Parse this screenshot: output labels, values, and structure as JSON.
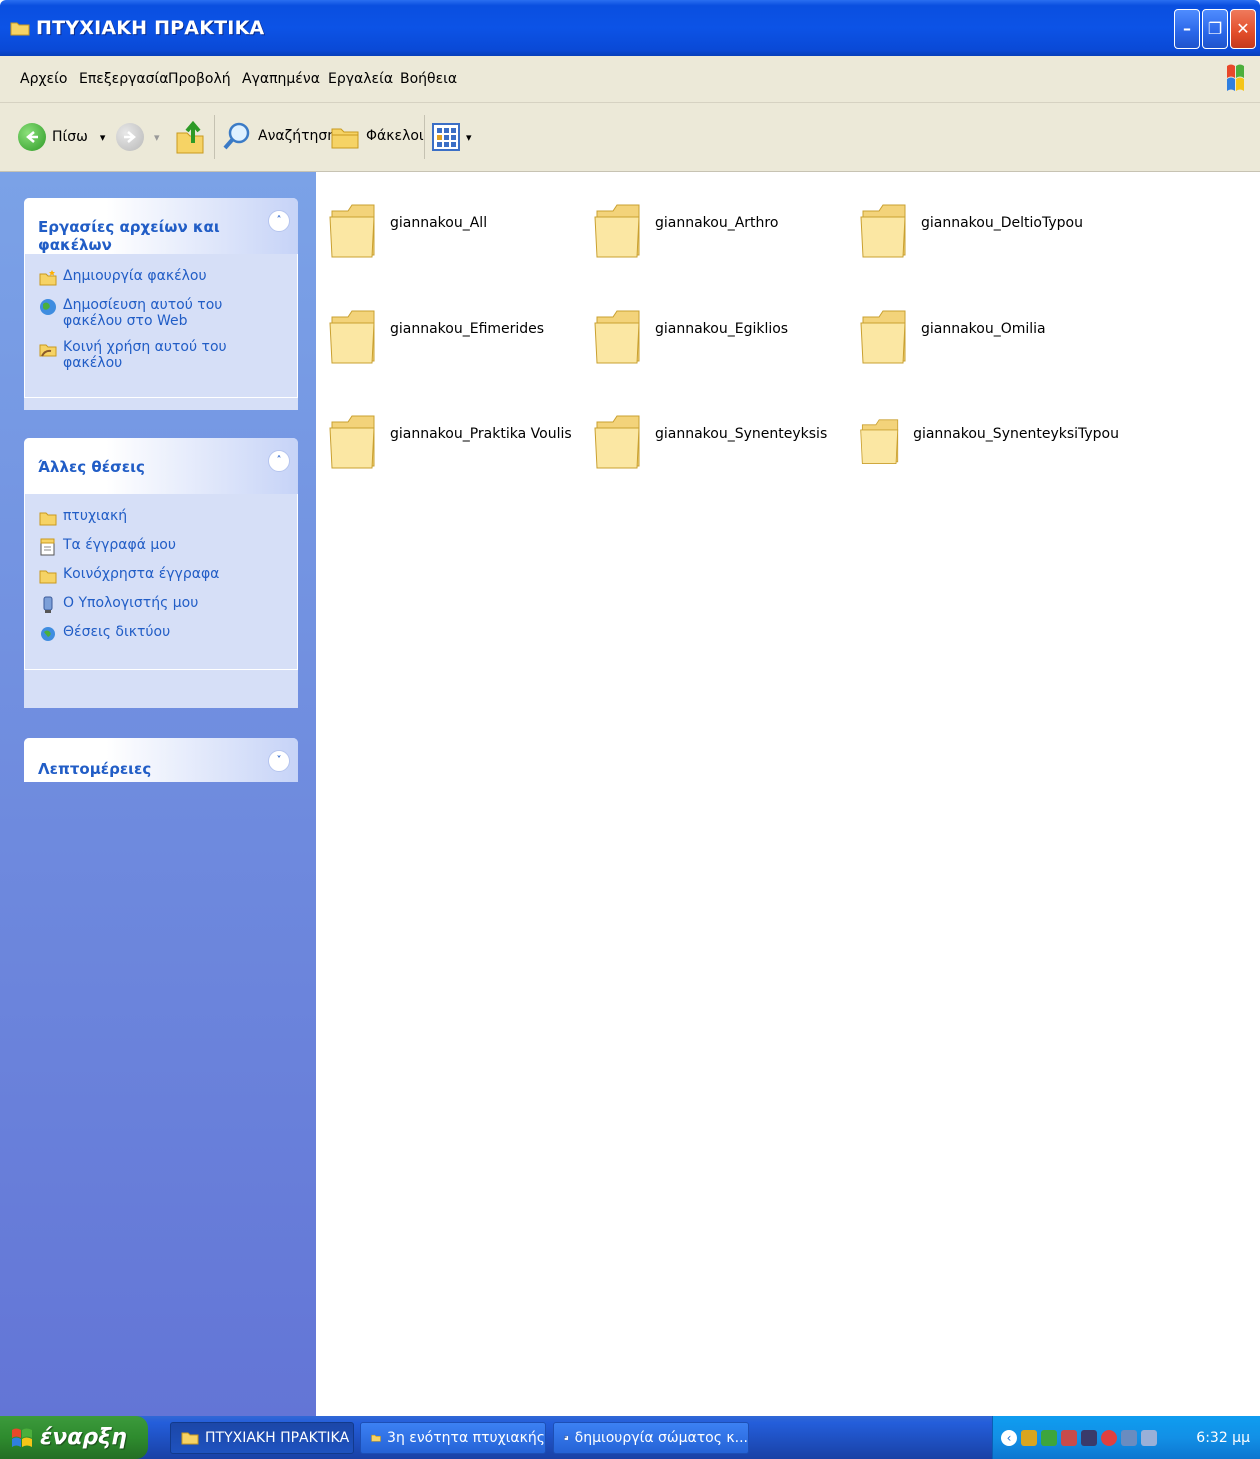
{
  "window": {
    "title": "ΠΤΥΧΙΑΚΗ ΠΡΑΚΤΙΚΑ",
    "minimize": "–",
    "restore": "❐",
    "close": "✕"
  },
  "menubar": {
    "items": [
      "Αρχείο",
      "Επεξεργασία",
      "Προβολή",
      "Αγαπημένα",
      "Εργαλεία",
      "Βοήθεια"
    ]
  },
  "toolbar": {
    "back_label": "Πίσω",
    "dropdown_arrow": "▾",
    "search_label": "Αναζήτηση",
    "folders_label": "Φάκελοι"
  },
  "left_pane": {
    "tasks_panel": {
      "title": "Εργασίες αρχείων και φακέλων",
      "collapse_glyph": "˄",
      "items": [
        {
          "label": "Δημιουργία φακέλου",
          "icon": "new-folder-icon"
        },
        {
          "label": "Δημοσίευση αυτού του φακέλου στο Web",
          "icon": "publish-web-icon"
        },
        {
          "label": "Κοινή χρήση αυτού του φακέλου",
          "icon": "share-folder-icon"
        }
      ]
    },
    "places_panel": {
      "title": "Άλλες θέσεις",
      "collapse_glyph": "˄",
      "items": [
        {
          "label": "πτυχιακή",
          "icon": "folder-icon"
        },
        {
          "label": "Τα έγγραφά μου",
          "icon": "my-documents-icon"
        },
        {
          "label": "Κοινόχρηστα έγγραφα",
          "icon": "folder-icon"
        },
        {
          "label": "Ο Υπολογιστής μου",
          "icon": "my-computer-icon"
        },
        {
          "label": "Θέσεις δικτύου",
          "icon": "network-places-icon"
        }
      ]
    },
    "details_panel": {
      "title": "Λεπτομέρειες",
      "expand_glyph": "˅"
    }
  },
  "folders": [
    "giannakou_All",
    "giannakou_Arthro",
    "giannakou_DeltioTypou",
    "giannakou_Efimerides",
    "giannakou_Egiklios",
    "giannakou_Omilia",
    "giannakou_Praktika Voulis",
    "giannakou_Synenteyksis",
    "giannakou_SynenteyksiTypou"
  ],
  "taskbar": {
    "start_label": "έναρξη",
    "buttons": [
      {
        "label": "ΠΤΥΧΙΑΚΗ ΠΡΑΚΤΙΚΑ",
        "icon": "folder-icon",
        "active": true
      },
      {
        "label": "3η ενότητα πτυχιακής",
        "icon": "folder-icon",
        "active": false
      },
      {
        "label": "δημιουργία σώματος κ...",
        "icon": "word-document-icon",
        "active": false
      }
    ],
    "clock": "6:32 μμ"
  },
  "colors": {
    "title_bar": "#0c53e6",
    "task_link": "#215dc6",
    "left_pane_top": "#7ba2e7",
    "left_pane_bottom": "#6375d6",
    "start_button": "#2e8b2e"
  }
}
